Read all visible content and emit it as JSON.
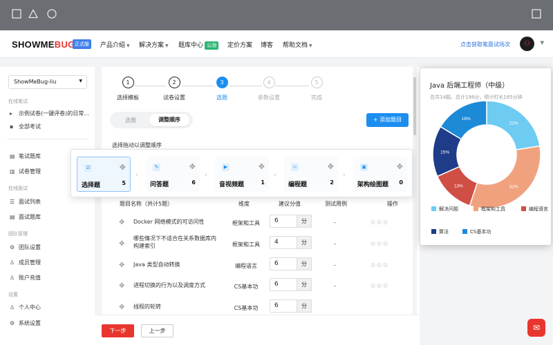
{
  "header": {
    "logo_main": "SHOWME",
    "logo_accent": "BUG",
    "version_badge": "正式版",
    "nav": [
      "产品介绍",
      "解决方案",
      "题库中心",
      "定价方案",
      "博客",
      "帮助文档"
    ],
    "free_badge": "公测",
    "cta": "点击获取笔面试场次"
  },
  "sidebar": {
    "tenant": "ShowMeBug-liu",
    "sec_written": "在线笔试",
    "tree": [
      "示例试卷(一键评卷)的日常...",
      "全部考试"
    ],
    "written_items": [
      "笔试题库",
      "试卷管理"
    ],
    "sec_interview": "在线面试",
    "interview_items": [
      "面试列表",
      "面试题库"
    ],
    "sec_team": "团队管理",
    "team_items": [
      "团队设置",
      "成员管理",
      "账户充值"
    ],
    "sec_settings": "设置",
    "settings_items": [
      "个人中心",
      "系统设置"
    ]
  },
  "steps": [
    {
      "num": "1",
      "label": "选择模板"
    },
    {
      "num": "2",
      "label": "试卷设置"
    },
    {
      "num": "3",
      "label": "选题"
    },
    {
      "num": "4",
      "label": "参数设置"
    },
    {
      "num": "5",
      "label": "完成"
    }
  ],
  "segment": {
    "opt1": "选题",
    "opt2": "调整顺序"
  },
  "add_button": "+ 添加题目",
  "hint": "选择拖动以调整顺序",
  "categories": [
    {
      "name": "选择题",
      "count": "5"
    },
    {
      "name": "问答题",
      "count": "6"
    },
    {
      "name": "音视频题",
      "count": "1"
    },
    {
      "name": "编程题",
      "count": "2"
    },
    {
      "name": "架构绘图题",
      "count": "0"
    }
  ],
  "table": {
    "headers": [
      "题目名称（共计5题）",
      "维度",
      "建议分值",
      "测试用例",
      "操作"
    ],
    "unit": "分",
    "rows": [
      {
        "q": "Docker 网络模式的可访问性",
        "dim": "框架和工具",
        "score": "6",
        "case": "-"
      },
      {
        "q": "哪些情况下不适合在关系数据库内构建索引",
        "dim": "框架和工具",
        "score": "4",
        "case": "-"
      },
      {
        "q": "Java 类型自动转换",
        "dim": "编程语言",
        "score": "6",
        "case": "-"
      },
      {
        "q": "进程切换的行为以及调度方式",
        "dim": "CS基本功",
        "score": "6",
        "case": "-"
      },
      {
        "q": "线程的轮转",
        "dim": "CS基本功",
        "score": "6",
        "case": ""
      }
    ]
  },
  "footer": {
    "next": "下一步",
    "prev": "上一步"
  },
  "popup": {
    "title": "Java 后端工程师（中级）",
    "subtitle": "总共14题。总计198分，预计时长165分钟",
    "legend": [
      "解决问题",
      "框架和工具",
      "编程语言",
      "算法",
      "CS基本功"
    ],
    "colors": [
      "#6ecbf2",
      "#f0a27f",
      "#cf4f45",
      "#1f3c88",
      "#1d8ad8"
    ],
    "percents": [
      "22%",
      "32%",
      "13%",
      "15%",
      "16%"
    ]
  },
  "chart_data": {
    "type": "pie",
    "categories": [
      "解决问题",
      "框架和工具",
      "编程语言",
      "算法",
      "CS基本功"
    ],
    "values": [
      22,
      32,
      13,
      15,
      16
    ],
    "title": "Java 后端工程师（中级）"
  }
}
